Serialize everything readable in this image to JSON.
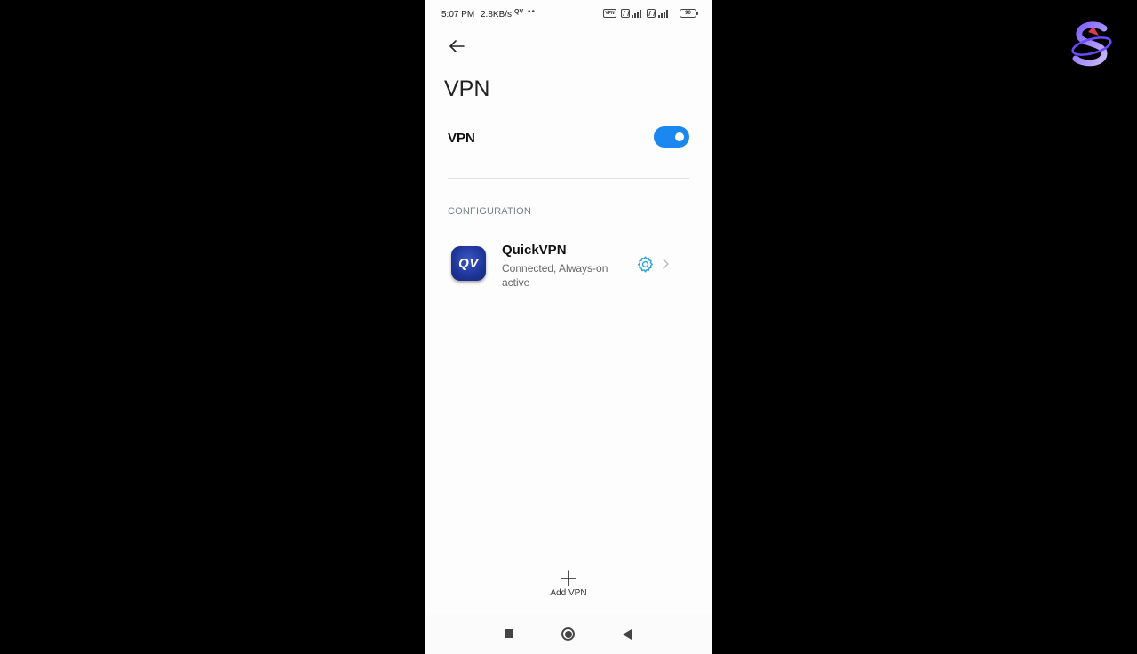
{
  "status_bar": {
    "time": "5:07 PM",
    "net_speed": "2.8KB/s",
    "app_indicator": "QV",
    "dots": "••",
    "vpn_badge": "VPN",
    "battery": "90"
  },
  "header": {
    "back_icon": "arrow-left-icon",
    "title": "VPN"
  },
  "vpn_toggle": {
    "label": "VPN",
    "enabled": true,
    "accent_color": "#1a88f0"
  },
  "configuration": {
    "section_header": "CONFIGURATION",
    "items": [
      {
        "icon_text": "QV",
        "name": "QuickVPN",
        "status": "Connected, Always-on active",
        "settings_icon": "gear-icon",
        "icon_color": "#29a3d6"
      }
    ]
  },
  "footer": {
    "add_icon": "plus-icon",
    "add_label": "Add VPN"
  },
  "nav_bar": {
    "recent_icon": "square-icon",
    "home_icon": "circle-icon",
    "back_icon": "triangle-back-icon"
  },
  "overlay": {
    "logo_icon": "channel-logo-s"
  }
}
